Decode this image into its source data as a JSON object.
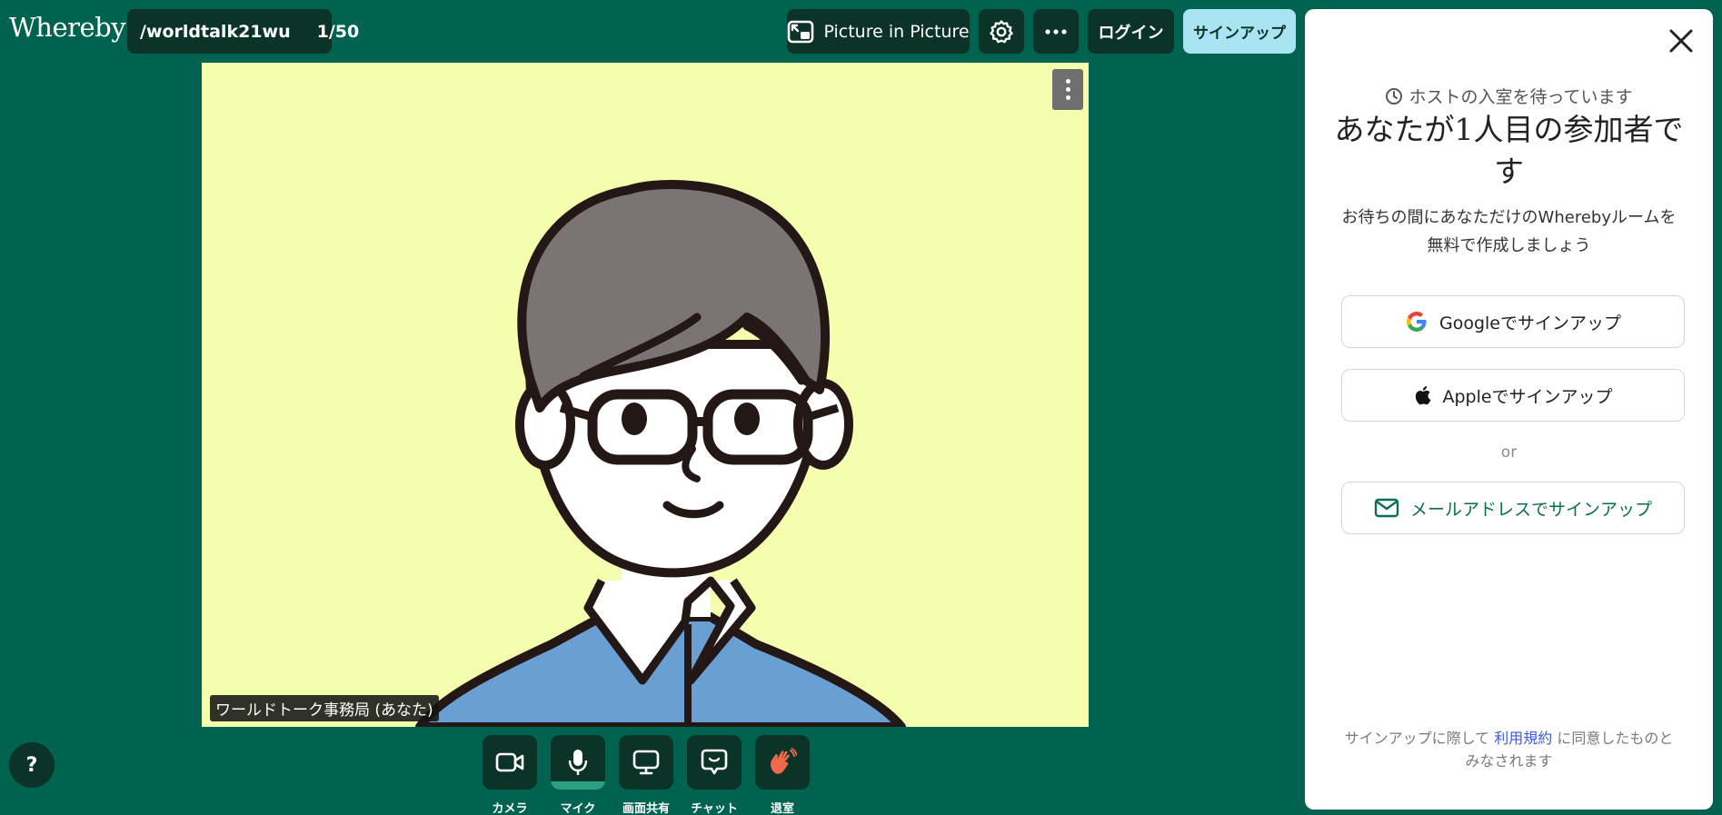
{
  "app": {
    "logo": "Whereby"
  },
  "room": {
    "name": "/worldtalk21wu",
    "count": "1/50"
  },
  "toolbar": {
    "pip_label": "Picture in Picture",
    "login_label": "ログイン",
    "signup_label": "サインアップ"
  },
  "video": {
    "participant_label": "ワールドトーク事務局 (あなた)"
  },
  "controls": {
    "help_label": "?",
    "camera_label": "カメラ",
    "mic_label": "マイク",
    "share_label": "画面共有",
    "chat_label": "チャット",
    "leave_label": "退室"
  },
  "panel": {
    "wait_text": "ホストの入室を待っています",
    "headline": "あなたが1人目の参加者です",
    "subtext": "お待ちの間にあなただけのWherebyルームを無料で作成しましょう",
    "google_label": "Googleでサインアップ",
    "apple_label": "Appleでサインアップ",
    "or_label": "or",
    "email_label": "メールアドレスでサインアップ",
    "terms_prefix": "サインアップに際して",
    "terms_link": "利用規約",
    "terms_suffix": "に同意したものとみなされます"
  },
  "colors": {
    "background": "#00634F",
    "dark_button": "#0B3327",
    "signup_accent": "#A8E4F2",
    "video_bg": "#F5FDAE",
    "shirt": "#6A9FD4",
    "hair": "#7A7474",
    "leave_icon": "#F06A4A"
  }
}
